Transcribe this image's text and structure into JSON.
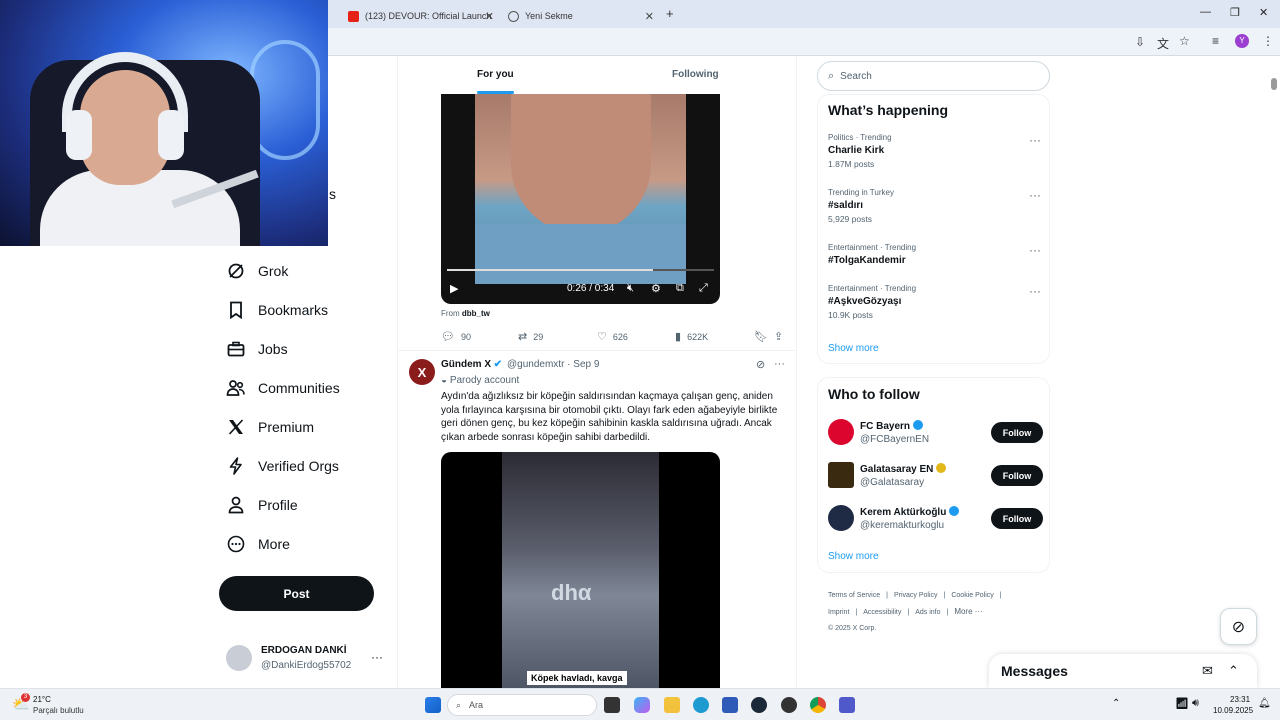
{
  "browser": {
    "tabs": [
      {
        "title": "(123) DEVOUR: Official Launch"
      },
      {
        "title": "Yeni Sekme"
      }
    ],
    "new_tab": "+",
    "profile_initial": "Y"
  },
  "left_nav": {
    "partial_label": "s",
    "items": [
      {
        "label": "Grok",
        "icon": "grok-icon"
      },
      {
        "label": "Bookmarks",
        "icon": "bookmark-icon"
      },
      {
        "label": "Jobs",
        "icon": "briefcase-icon"
      },
      {
        "label": "Communities",
        "icon": "communities-icon"
      },
      {
        "label": "Premium",
        "icon": "x-logo-icon"
      },
      {
        "label": "Verified Orgs",
        "icon": "lightning-icon"
      },
      {
        "label": "Profile",
        "icon": "person-icon"
      },
      {
        "label": "More",
        "icon": "more-circle-icon"
      }
    ],
    "post_label": "Post",
    "account": {
      "name": "ERDOGAN DANKİ",
      "handle": "@DankiErdog55702",
      "more": "···"
    }
  },
  "feed": {
    "tabs": [
      {
        "label": "For you",
        "active": true
      },
      {
        "label": "Following",
        "active": false
      }
    ],
    "tweet1": {
      "video": {
        "time": "0:26 / 0:34",
        "progress": 0.77
      },
      "from_prefix": "From ",
      "from_account": "dbb_tw",
      "replies": "90",
      "reposts": "29",
      "likes": "626",
      "views": "622K"
    },
    "tweet2": {
      "avatar_letter": "X",
      "name": "Gündem X",
      "meta": "@gundemxtr · Sep 9",
      "parody": "Parody account",
      "text": "Aydın'da ağızlıksız bir köpeğin saldırısından kaçmaya çalışan genç, aniden yola fırlayınca karşısına bir otomobil çıktı. Olayı fark eden ağabeyiyle birlikte geri dönen genç, bu kez köpeğin sahibinin kaskla saldırısına uğradı. Ancak çıkan arbede sonrası köpeğin sahibi darbedildi.",
      "video_watermark": "dhα",
      "video_caption": "Köpek havladı, kavga"
    }
  },
  "right": {
    "search_placeholder": "Search",
    "happening": {
      "title": "What’s happening",
      "trends": [
        {
          "category": "Politics · Trending",
          "name": "Charlie Kirk",
          "count": "1.87M posts"
        },
        {
          "category": "Trending in Turkey",
          "name": "#saldırı",
          "count": "5,929 posts"
        },
        {
          "category": "Entertainment · Trending",
          "name": "#TolgaKandemir",
          "count": ""
        },
        {
          "category": "Entertainment · Trending",
          "name": "#AşkveGözyaşı",
          "count": "10.9K posts"
        }
      ],
      "show_more": "Show more"
    },
    "who_to_follow": {
      "title": "Who to follow",
      "accounts": [
        {
          "name": "FC Bayern",
          "handle": "@FCBayernEN",
          "badge_color": "#1d9bf0",
          "avatar_color": "#dc052d"
        },
        {
          "name": "Galatasaray EN",
          "handle": "@Galatasaray",
          "badge_color": "#e2b719",
          "avatar_color": "#3a2a10"
        },
        {
          "name": "Kerem Aktürkoğlu",
          "handle": "@keremakturkoglu",
          "badge_color": "#1d9bf0",
          "avatar_color": "#1f2a44"
        }
      ],
      "follow_label": "Follow",
      "show_more": "Show more"
    },
    "footer": {
      "links": [
        "Terms of Service",
        "|",
        "Privacy Policy",
        "|",
        "Cookie Policy",
        "|",
        "Imprint",
        "|",
        "Accessibility",
        "|",
        "Ads info",
        "|",
        "More ···"
      ],
      "copyright": "© 2025 X Corp."
    },
    "messages_title": "Messages"
  },
  "taskbar": {
    "weather_temp": "21°C",
    "weather_desc": "Parçalı bulutlu",
    "weather_badge": "3",
    "search_label": "Ara",
    "time": "23:31",
    "date": "10.09.2025"
  },
  "colors": {
    "accent": "#1d9bf0",
    "dark": "#0f1419",
    "muted": "#536471"
  }
}
